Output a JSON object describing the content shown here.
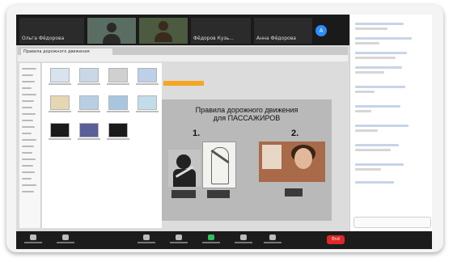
{
  "meeting": {
    "participants": [
      {
        "name": "Ольга Фёдорова"
      },
      {
        "name": ""
      },
      {
        "name": ""
      },
      {
        "name": "Фёдоров Кузь..."
      },
      {
        "name": "Анна Фёдорова"
      }
    ],
    "self_initial": "A"
  },
  "shared": {
    "browser_tab": "Правила дорожного движения",
    "slide": {
      "title_line1": "Правила дорожного движения",
      "title_line2": "для ПАССАЖИРОВ",
      "number1": "1.",
      "number2": "2."
    }
  },
  "controls": {
    "end_label": "End"
  },
  "colors": {
    "zoom_blue": "#2d8cff",
    "share_green": "#2fbf5b",
    "end_red": "#e02828",
    "highlight_orange": "#f5a623"
  }
}
